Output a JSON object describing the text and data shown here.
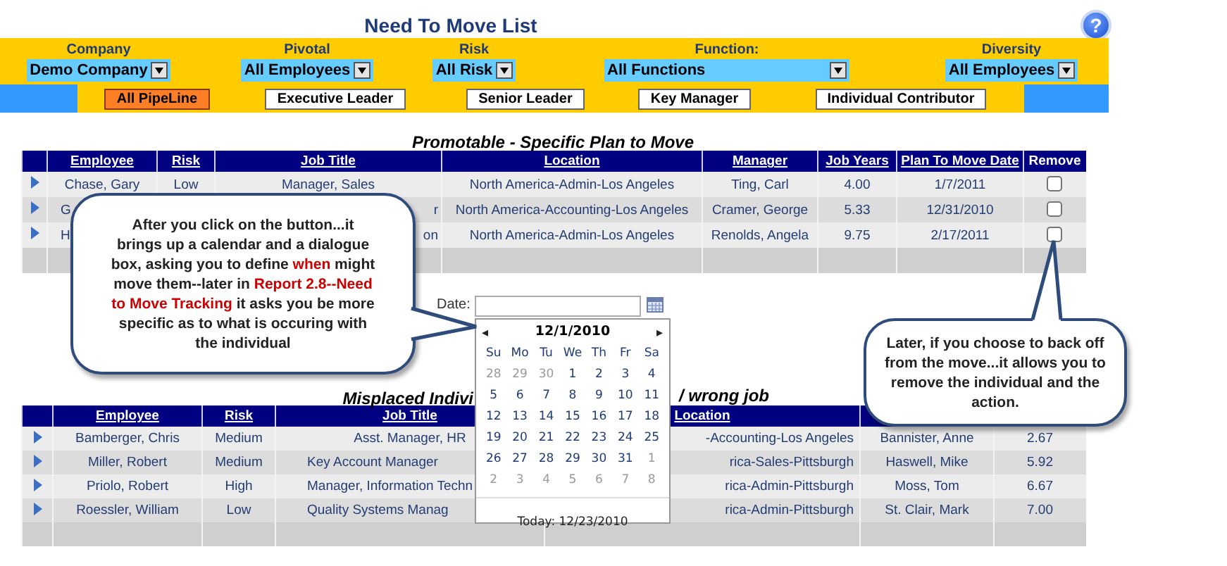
{
  "title": "Need To Move List",
  "help": "?",
  "filters": [
    {
      "label": "Company",
      "value": "Demo Company"
    },
    {
      "label": "Pivotal",
      "value": "All Employees"
    },
    {
      "label": "Risk",
      "value": "All Risk"
    },
    {
      "label": "Function:",
      "value": "All Functions"
    },
    {
      "label": "Diversity",
      "value": "All Employees"
    }
  ],
  "segments": [
    {
      "label": "All PipeLine",
      "selected": true
    },
    {
      "label": "Executive Leader",
      "selected": false
    },
    {
      "label": "Senior Leader",
      "selected": false
    },
    {
      "label": "Key Manager",
      "selected": false
    },
    {
      "label": "Individual Contributor",
      "selected": false
    }
  ],
  "promotable": {
    "title": "Promotable - Specific Plan to Move",
    "columns": [
      {
        "label": "Employee",
        "link": true
      },
      {
        "label": "Risk",
        "link": true
      },
      {
        "label": "Job Title",
        "link": true
      },
      {
        "label": "Location",
        "link": true
      },
      {
        "label": "Manager",
        "link": true
      },
      {
        "label": "Job Years",
        "link": true
      },
      {
        "label": "Plan To Move Date",
        "link": true
      },
      {
        "label": "Remove",
        "link": false
      }
    ],
    "rows": [
      {
        "cells": [
          {
            "text": "Chase, Gary"
          },
          {
            "text": "Low"
          },
          {
            "text": "Manager, Sales"
          },
          {
            "text": "North America-Admin-Los Angeles"
          },
          {
            "text": "Ting, Carl"
          },
          {
            "text": "4.00"
          },
          {
            "text": "1/7/2011"
          }
        ],
        "remove_checked": false
      },
      {
        "cells": [
          {
            "text": "G",
            "end_hidden": true
          },
          null,
          {
            "text": "r",
            "start_hidden": true
          },
          {
            "text": "North America-Accounting-Los Angeles"
          },
          {
            "text": "Cramer, George"
          },
          {
            "text": "5.33"
          },
          {
            "text": "12/31/2010"
          }
        ],
        "remove_checked": false
      },
      {
        "cells": [
          {
            "text": "H",
            "end_hidden": true
          },
          null,
          {
            "text": "on",
            "start_hidden": true
          },
          {
            "text": "North America-Admin-Los Angeles"
          },
          {
            "text": "Renolds, Angela"
          },
          {
            "text": "9.75"
          },
          {
            "text": "2/17/2011"
          }
        ],
        "remove_checked": false
      }
    ]
  },
  "misplaced": {
    "title_parts": [
      "Misplaced Indivi",
      "/ wrong job"
    ],
    "columns": [
      {
        "label": "Employee",
        "link": true
      },
      {
        "label": "Risk",
        "link": true
      },
      {
        "label": "Job Title",
        "link": true
      },
      {
        "label": "Location",
        "link": true
      },
      null,
      null
    ],
    "rows": [
      {
        "cells": [
          {
            "text": "Bamberger, Chris"
          },
          {
            "text": "Medium"
          },
          {
            "text": "Asst. Manager, HR"
          },
          {
            "text": "-Accounting-Los Angeles",
            "start_hidden": true
          },
          {
            "text": "Bannister, Anne"
          },
          {
            "text": "2.67"
          }
        ]
      },
      {
        "cells": [
          {
            "text": "Miller, Robert"
          },
          {
            "text": "Medium"
          },
          {
            "text": "Key Account Manager",
            "end_hidden": true
          },
          {
            "text": "rica-Sales-Pittsburgh",
            "start_hidden": true
          },
          {
            "text": "Haswell, Mike"
          },
          {
            "text": "5.92"
          }
        ]
      },
      {
        "cells": [
          {
            "text": "Priolo, Robert"
          },
          {
            "text": "High"
          },
          {
            "text": "Manager, Information Techn",
            "end_hidden": true
          },
          {
            "text": "rica-Admin-Pittsburgh",
            "start_hidden": true
          },
          {
            "text": "Moss, Tom"
          },
          {
            "text": "6.67"
          }
        ]
      },
      {
        "cells": [
          {
            "text": "Roessler, William"
          },
          {
            "text": "Low"
          },
          {
            "text": "Quality Systems Manag",
            "end_hidden": true
          },
          {
            "text": "rica-Admin-Pittsburgh",
            "start_hidden": true
          },
          {
            "text": "St. Clair, Mark"
          },
          {
            "text": "7.00"
          }
        ]
      }
    ]
  },
  "date_picker": {
    "label": "Date:",
    "month": "12/1/2010",
    "prev": "◂",
    "next": "▸",
    "weekdays": [
      "Su",
      "Mo",
      "Tu",
      "We",
      "Th",
      "Fr",
      "Sa"
    ],
    "weeks": [
      [
        {
          "label": "28",
          "other_month": true
        },
        {
          "label": "29",
          "other_month": true
        },
        {
          "label": "30",
          "other_month": true
        },
        {
          "label": "1",
          "other_month": false
        },
        {
          "label": "2",
          "other_month": false
        },
        {
          "label": "3",
          "other_month": false
        },
        {
          "label": "4",
          "other_month": false
        }
      ],
      [
        {
          "label": "5",
          "other_month": false
        },
        {
          "label": "6",
          "other_month": false
        },
        {
          "label": "7",
          "other_month": false
        },
        {
          "label": "8",
          "other_month": false
        },
        {
          "label": "9",
          "other_month": false
        },
        {
          "label": "10",
          "other_month": false
        },
        {
          "label": "11",
          "other_month": false
        }
      ],
      [
        {
          "label": "12",
          "other_month": false
        },
        {
          "label": "13",
          "other_month": false
        },
        {
          "label": "14",
          "other_month": false
        },
        {
          "label": "15",
          "other_month": false
        },
        {
          "label": "16",
          "other_month": false
        },
        {
          "label": "17",
          "other_month": false
        },
        {
          "label": "18",
          "other_month": false
        }
      ],
      [
        {
          "label": "19",
          "other_month": false
        },
        {
          "label": "20",
          "other_month": false
        },
        {
          "label": "21",
          "other_month": false
        },
        {
          "label": "22",
          "other_month": false
        },
        {
          "label": "23",
          "other_month": false
        },
        {
          "label": "24",
          "other_month": false
        },
        {
          "label": "25",
          "other_month": false
        }
      ],
      [
        {
          "label": "26",
          "other_month": false
        },
        {
          "label": "27",
          "other_month": false
        },
        {
          "label": "28",
          "other_month": false
        },
        {
          "label": "29",
          "other_month": false
        },
        {
          "label": "30",
          "other_month": false
        },
        {
          "label": "31",
          "other_month": false
        },
        {
          "label": "1",
          "other_month": true
        }
      ],
      [
        {
          "label": "2",
          "other_month": true
        },
        {
          "label": "3",
          "other_month": true
        },
        {
          "label": "4",
          "other_month": true
        },
        {
          "label": "5",
          "other_month": true
        },
        {
          "label": "6",
          "other_month": true
        },
        {
          "label": "7",
          "other_month": true
        },
        {
          "label": "8",
          "other_month": true
        }
      ]
    ],
    "today": "Today: 12/23/2010"
  },
  "callouts": [
    {
      "kind": "left",
      "text": "After you click on the button...it brings up a calendar and a dialogue box, asking you to define **when** might move them--later in **Report 2.8--Need to Move Tracking** it asks you be more specific as to what is occuring with the individual"
    },
    {
      "kind": "up",
      "text": "Later, if you choose to back off from the move...it allows you to remove the individual and the action."
    }
  ]
}
